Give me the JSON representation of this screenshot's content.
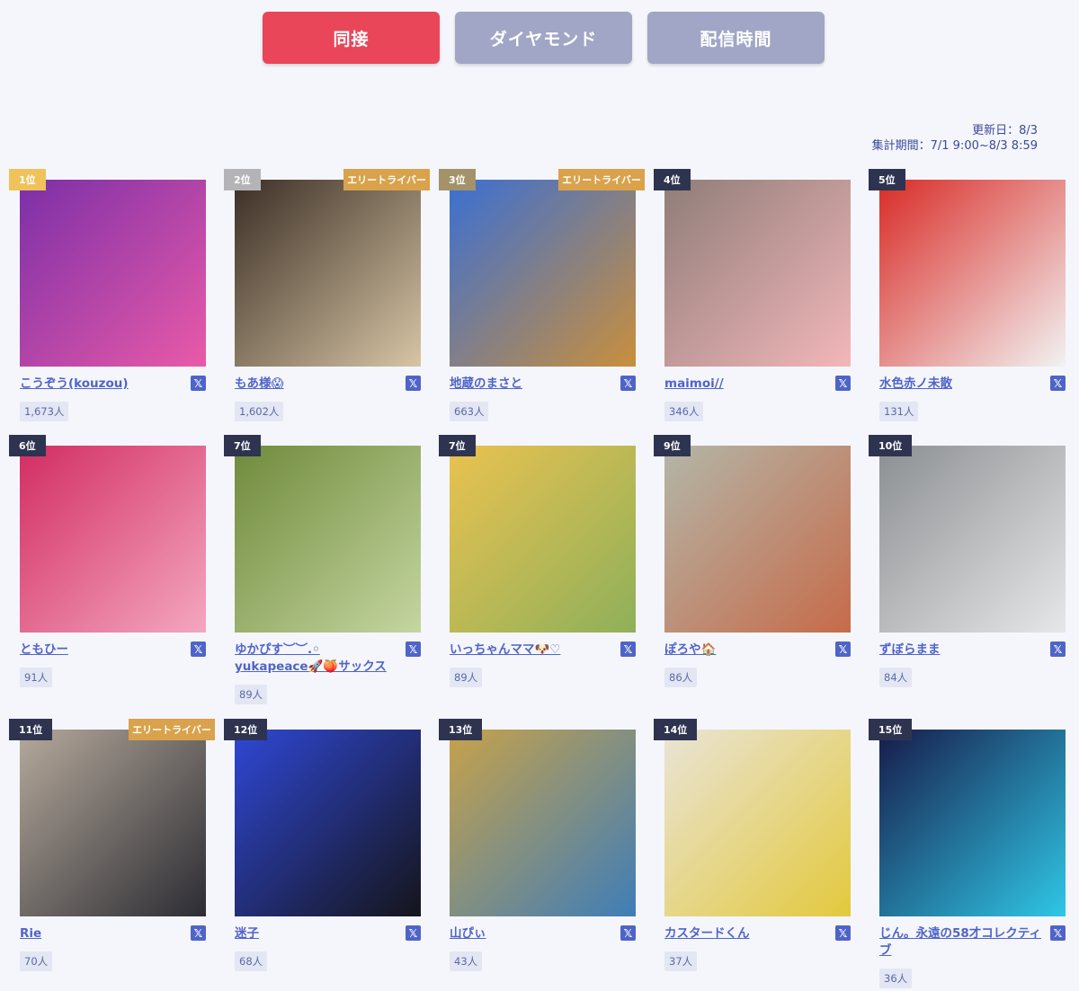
{
  "tabs": [
    {
      "label": "同接",
      "active": true
    },
    {
      "label": "ダイヤモンド",
      "active": false
    },
    {
      "label": "配信時間",
      "active": false
    }
  ],
  "updated": "更新日：8/3",
  "period": "集計期間：7/1 9:00~8/3 8:59",
  "elite_label": "エリートライバー",
  "x_glyph": "𝕏",
  "rankings": [
    {
      "rank": "1位",
      "name": "こうぞう(kouzou)",
      "count": "1,673人",
      "elite": false,
      "rank_color": "gold",
      "photo_colors": [
        "#7b2fa8",
        "#e95aa8"
      ]
    },
    {
      "rank": "2位",
      "name": "もあ様😱",
      "count": "1,602人",
      "elite": true,
      "rank_color": "silver",
      "photo_colors": [
        "#3b2e25",
        "#d7c5a5"
      ]
    },
    {
      "rank": "3位",
      "name": "地蔵のまさと",
      "count": "663人",
      "elite": true,
      "rank_color": "bronze",
      "photo_colors": [
        "#3a6fd4",
        "#c98f3d"
      ]
    },
    {
      "rank": "4位",
      "name": "maimoi//",
      "count": "346人",
      "elite": false,
      "rank_color": "navy",
      "photo_colors": [
        "#8f7d78",
        "#f3b7ba"
      ]
    },
    {
      "rank": "5位",
      "name": "水色赤ノ未散",
      "count": "131人",
      "elite": false,
      "rank_color": "navy",
      "photo_colors": [
        "#d92b26",
        "#f2f2f2"
      ]
    },
    {
      "rank": "6位",
      "name": "ともひー",
      "count": "91人",
      "elite": false,
      "rank_color": "navy",
      "photo_colors": [
        "#d22d63",
        "#f4a7c0"
      ]
    },
    {
      "rank": "7位",
      "name": "ゆかぴす︶︶.◦ yukapeace🚀🍑サックス",
      "count": "89人",
      "elite": false,
      "rank_color": "navy",
      "photo_colors": [
        "#6f8a3b",
        "#c5d6a1"
      ]
    },
    {
      "rank": "7位",
      "name": "いっちゃんママ🐶♡",
      "count": "89人",
      "elite": false,
      "rank_color": "navy",
      "photo_colors": [
        "#e9c250",
        "#8fb05a"
      ]
    },
    {
      "rank": "9位",
      "name": "ぽろや🏠",
      "count": "86人",
      "elite": false,
      "rank_color": "navy",
      "photo_colors": [
        "#b3b6a8",
        "#c66b4a"
      ]
    },
    {
      "rank": "10位",
      "name": "ずぼらまま",
      "count": "84人",
      "elite": false,
      "rank_color": "navy",
      "photo_colors": [
        "#8c8f92",
        "#e6e7e8"
      ]
    },
    {
      "rank": "11位",
      "name": "Rie",
      "count": "70人",
      "elite": true,
      "rank_color": "navy",
      "photo_colors": [
        "#b5a99b",
        "#2c2c33"
      ]
    },
    {
      "rank": "12位",
      "name": "迷子",
      "count": "68人",
      "elite": false,
      "rank_color": "navy",
      "photo_colors": [
        "#2f47d6",
        "#15151a"
      ]
    },
    {
      "rank": "13位",
      "name": "山ぴぃ",
      "count": "43人",
      "elite": false,
      "rank_color": "navy",
      "photo_colors": [
        "#c7a24a",
        "#3f7db8"
      ]
    },
    {
      "rank": "14位",
      "name": "カスタードくん",
      "count": "37人",
      "elite": false,
      "rank_color": "navy",
      "photo_colors": [
        "#e9e4d6",
        "#e3c93d"
      ]
    },
    {
      "rank": "15位",
      "name": "じん。永遠の58才コレクティブ",
      "count": "36人",
      "elite": false,
      "rank_color": "navy",
      "photo_colors": [
        "#171b4a",
        "#2fc7e6"
      ]
    }
  ]
}
